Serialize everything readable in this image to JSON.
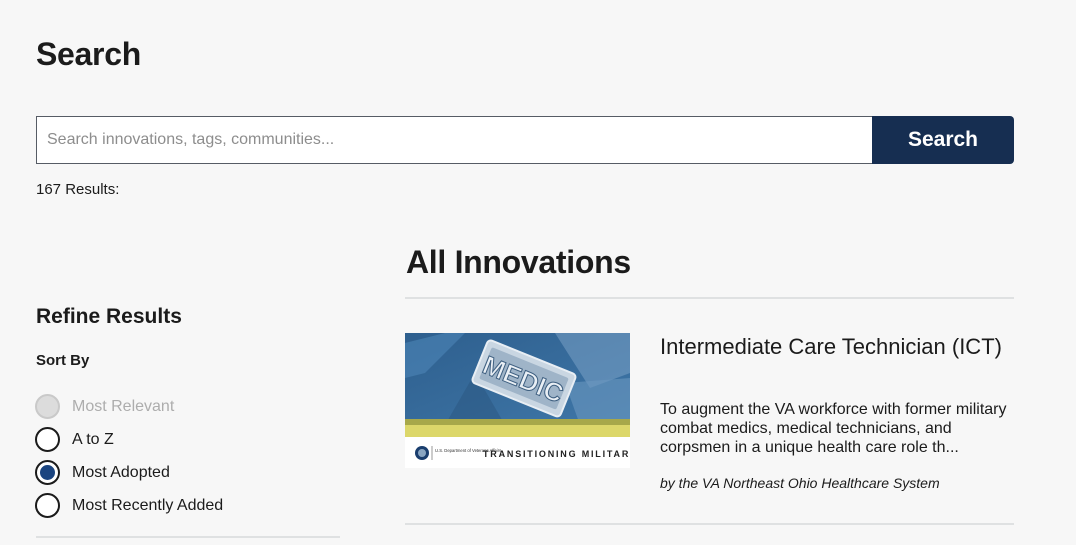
{
  "page": {
    "title": "Search"
  },
  "search": {
    "placeholder": "Search innovations, tags, communities...",
    "value": "",
    "button_label": "Search"
  },
  "results": {
    "count_label": "167 Results:"
  },
  "refine": {
    "title": "Refine Results",
    "sort_label": "Sort By",
    "options": [
      {
        "label": "Most Relevant",
        "state": "disabled"
      },
      {
        "label": "A to Z",
        "state": "unchecked"
      },
      {
        "label": "Most Adopted",
        "state": "checked"
      },
      {
        "label": "Most Recently Added",
        "state": "unchecked"
      }
    ]
  },
  "innovations": {
    "title": "All Innovations",
    "cards": [
      {
        "title": "Intermediate Care Technician (ICT)",
        "description": "To augment the VA workforce with former military combat medics, medical technicians, and corpsmen in a unique health care role th...",
        "origin": "by the VA Northeast Ohio Healthcare System",
        "image": {
          "badge_text": "MEDIC",
          "seal_text": "U.S. Department of Veterans Affairs",
          "banner_text": "TRANSITIONING MILITAR"
        }
      }
    ]
  },
  "colors": {
    "primary": "#162e51",
    "radio_checked": "#1a4480",
    "background": "#f7f7f7",
    "divider": "#dfe1e2"
  }
}
